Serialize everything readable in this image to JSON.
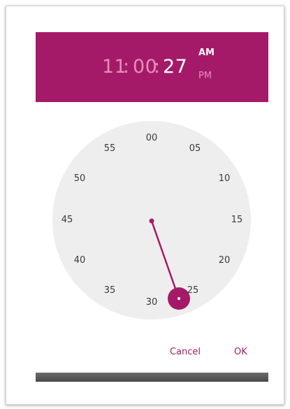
{
  "header": {
    "hours": "11",
    "sep1": ":",
    "minutes": "00",
    "sep2": ":",
    "seconds": "27",
    "am_label": "AM",
    "pm_label": "PM"
  },
  "dial": {
    "labels": [
      "00",
      "05",
      "10",
      "15",
      "20",
      "25",
      "30",
      "35",
      "40",
      "45",
      "50",
      "55"
    ],
    "selected_value": "27"
  },
  "footer": {
    "cancel_label": "Cancel",
    "ok_label": "OK"
  },
  "colors": {
    "accent": "#a51a68",
    "header_dim_text": "#e38fb9",
    "dial_face": "#eeeeee"
  }
}
